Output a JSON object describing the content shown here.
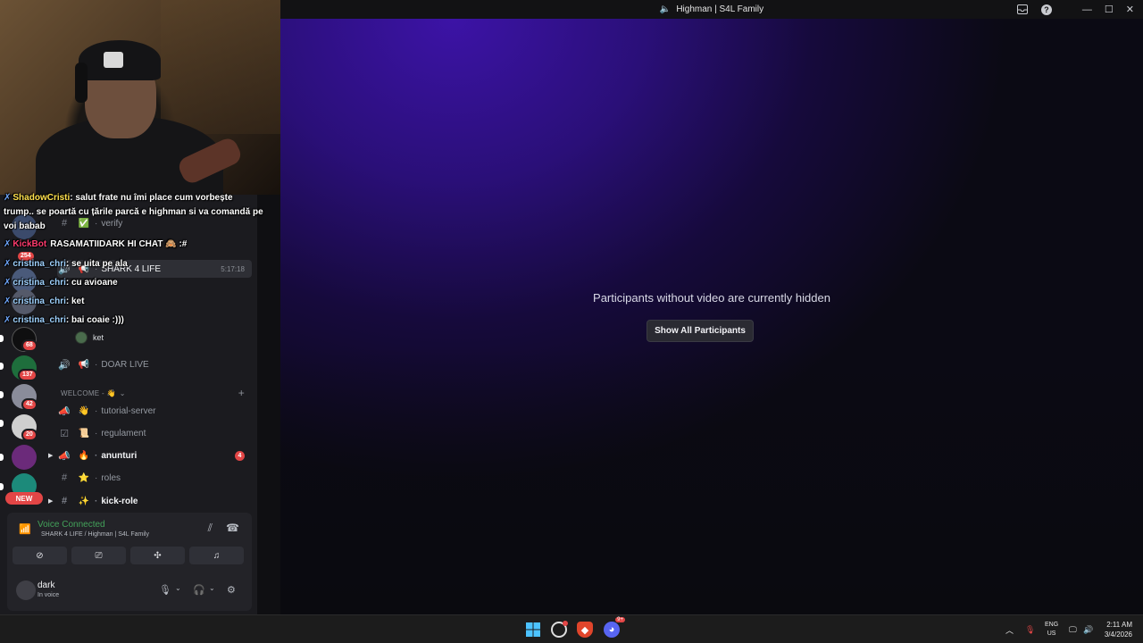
{
  "window": {
    "title": "Highman | S4L Family",
    "title_icon": "speaker-icon",
    "controls": [
      "inbox-icon",
      "help-icon",
      "minimize-icon",
      "maximize-icon",
      "close-icon"
    ]
  },
  "stage": {
    "hidden_message": "Participants without video are currently hidden",
    "show_all_button": "Show All Participants"
  },
  "guilds": [
    {
      "badge": "254"
    },
    {
      "badge": ""
    },
    {
      "badge": ""
    },
    {
      "badge": ""
    },
    {
      "badge": "68"
    },
    {
      "badge": "137"
    },
    {
      "badge": "42"
    },
    {
      "badge": "20"
    },
    {
      "badge": ""
    },
    {
      "badge": ""
    }
  ],
  "new_badge": "NEW",
  "channels": {
    "verify": "verify",
    "shark": "SHARK 4 LIFE",
    "shark_time": "5:17:18",
    "voice_user": "ket",
    "doar_live": "DOAR LIVE",
    "category_welcome": "WELCOME - 👋",
    "tutorial": "tutorial-server",
    "regulament": "regulament",
    "anunturi": "anunturi",
    "anunturi_badge": "4",
    "roles": "roles",
    "kick_role": "kick-role"
  },
  "voice_panel": {
    "status": "Voice Connected",
    "location": "SHARK 4 LIFE / Highman | S4L Family",
    "user_name": "dark",
    "user_status": "In voice"
  },
  "chat": [
    {
      "user": "ShadowCristi",
      "text": ": salut frate nu îmi place cum vorbește"
    },
    {
      "user": "",
      "text": "trump.. se poartă cu țările parcă e highman si va comandă pe"
    },
    {
      "user": "",
      "text": "voi babab"
    },
    {
      "user": "KickBot",
      "text": "RASAMATIIDARK HI CHAT 🙈 :#"
    },
    {
      "user": "cristina_chri",
      "text": ": se uita pe ala"
    },
    {
      "user": "cristina_chri",
      "text": ": cu avioane"
    },
    {
      "user": "cristina_chri",
      "text": ": ket"
    },
    {
      "user": "cristina_chri",
      "text": ": bai coaie :)))"
    }
  ],
  "taskbar": {
    "lang_top": "ENG",
    "lang_bottom": "US",
    "time": "2:11 AM",
    "date": "3/4/2026",
    "discord_badge": "9+"
  },
  "colors": {
    "accent_green": "#43a25a",
    "badge_red": "#e34646",
    "stage_purple": "#3c13a6"
  }
}
